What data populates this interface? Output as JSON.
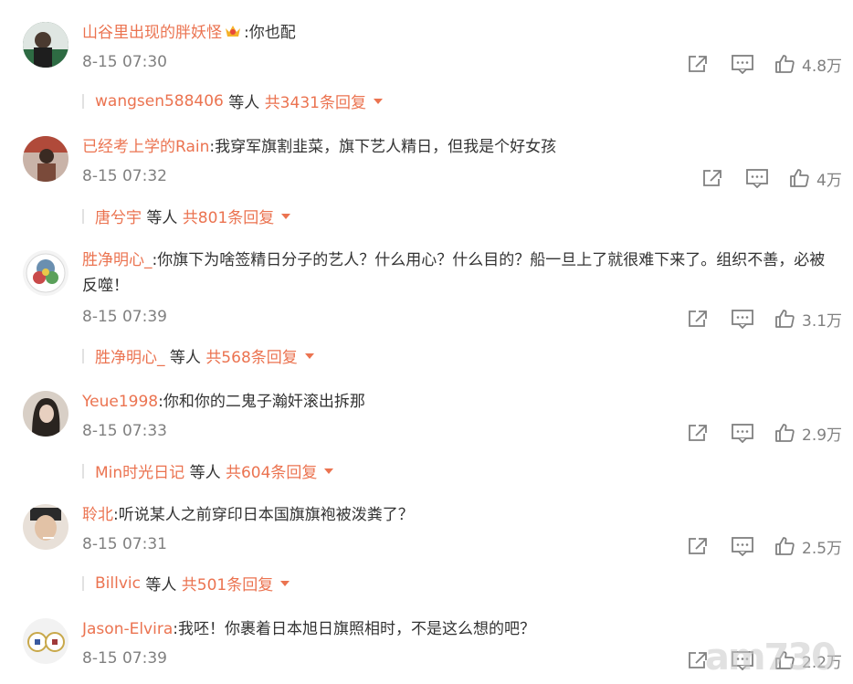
{
  "comments": [
    {
      "user": "山谷里出现的胖妖怪",
      "text": "你也配",
      "time": "8-15 07:30",
      "likes": "4.8万",
      "reply_name": "wangsen588406",
      "reply_mid": "等人",
      "reply_count": "共3431条回复"
    },
    {
      "user": "已经考上学的Rain",
      "text": "我穿军旗割韭菜，旗下艺人精日，但我是个好女孩",
      "time": "8-15 07:32",
      "likes": "4万",
      "reply_name": "唐兮宇",
      "reply_mid": "等人",
      "reply_count": "共801条回复"
    },
    {
      "user": "胜净明心_",
      "text": "你旗下为啥签精日分子的艺人？什么用心？什么目的？船一旦上了就很难下来了。组织不善，必被反噬！",
      "time": "8-15 07:39",
      "likes": "3.1万",
      "reply_name": "胜净明心_",
      "reply_mid": "等人",
      "reply_count": "共568条回复"
    },
    {
      "user": "Yeue1998",
      "text": "你和你的二鬼子瀚奸滚出拆那",
      "time": "8-15 07:33",
      "likes": "2.9万",
      "reply_name": "Min时光日记",
      "reply_mid": "等人",
      "reply_count": "共604条回复"
    },
    {
      "user": "聆北",
      "text": "听说某人之前穿印日本国旗旗袍被泼粪了？",
      "time": "8-15 07:31",
      "likes": "2.5万",
      "reply_name": "Billvic",
      "reply_mid": "等人",
      "reply_count": "共501条回复"
    },
    {
      "user": "Jason-Elvira",
      "text": "我呸！你裹着日本旭日旗照相时，不是这么想的吧？",
      "time": "8-15 07:39",
      "likes": "2.2万"
    }
  ],
  "watermark": "am730",
  "colors": {
    "accent": "#eb7350",
    "meta": "#808080"
  },
  "icons": [
    "share-icon",
    "comment-icon",
    "like-icon",
    "crown-badge-icon",
    "dropdown-arrow-icon"
  ]
}
